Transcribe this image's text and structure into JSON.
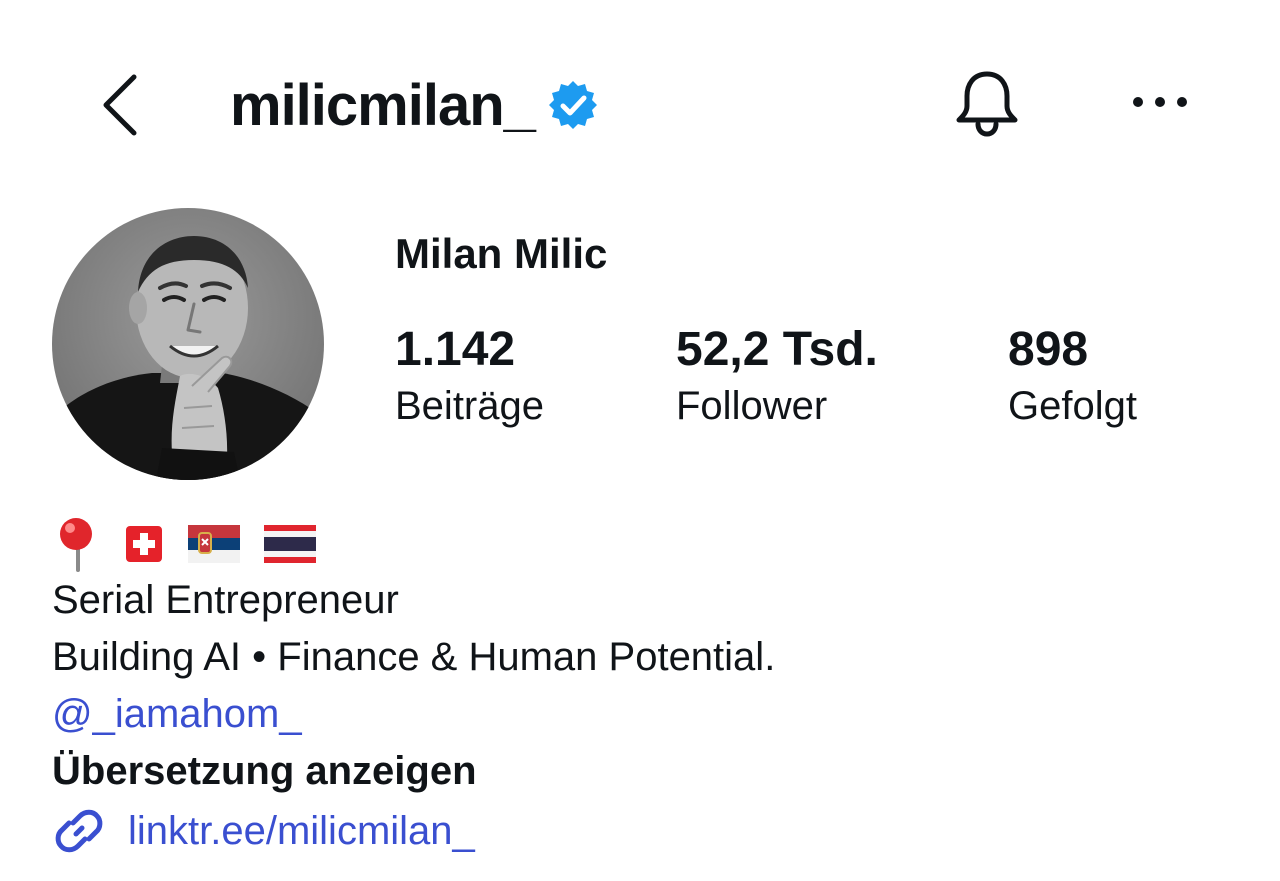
{
  "header": {
    "username": "milicmilan_",
    "verified": true
  },
  "profile": {
    "display_name": "Milan Milic",
    "stats": {
      "posts": {
        "count": "1.142",
        "label": "Beiträge"
      },
      "followers": {
        "count": "52,2 Tsd.",
        "label": "Follower"
      },
      "following": {
        "count": "898",
        "label": "Gefolgt"
      }
    }
  },
  "bio": {
    "emojis": [
      "round-pushpin",
      "flag-switzerland",
      "flag-serbia",
      "flag-thailand"
    ],
    "lines": [
      "Serial Entrepreneur",
      "Building AI • Finance & Human Potential."
    ],
    "mention": "@_iamahom_",
    "translate_label": "Übersetzung anzeigen",
    "link": "linktr.ee/milicmilan_"
  },
  "colors": {
    "verified_blue": "#1d9bf0",
    "link_blue": "#3a4fd0",
    "text": "#101418"
  }
}
